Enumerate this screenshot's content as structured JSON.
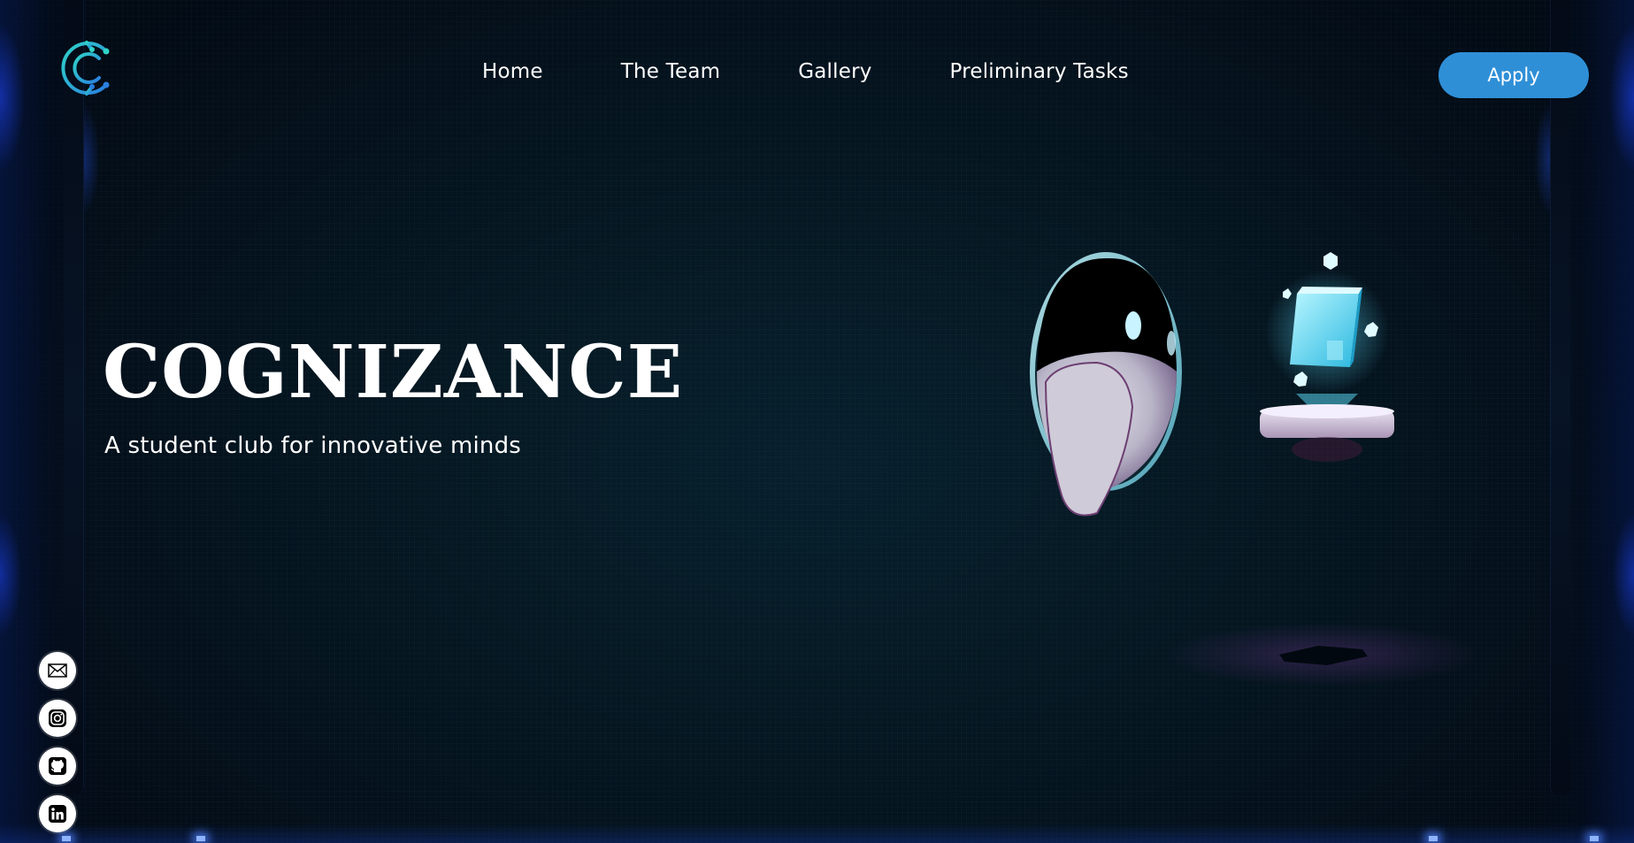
{
  "nav": {
    "links": [
      {
        "label": "Home"
      },
      {
        "label": "The Team"
      },
      {
        "label": "Gallery"
      },
      {
        "label": "Preliminary Tasks"
      }
    ],
    "apply_label": "Apply",
    "logo_icon": "cognizance-c-logo-icon"
  },
  "hero": {
    "title": "COGNIZANCE",
    "subtitle": "A student club for innovative minds"
  },
  "socials": [
    {
      "icon": "mail-icon"
    },
    {
      "icon": "instagram-icon"
    },
    {
      "icon": "github-icon"
    },
    {
      "icon": "linkedin-icon"
    }
  ],
  "colors": {
    "background": "#04101b",
    "accent": "#2f8fd6",
    "text": "#ffffff",
    "frame_glow": "#1e46ff",
    "hologram": "#5ee3ff"
  }
}
